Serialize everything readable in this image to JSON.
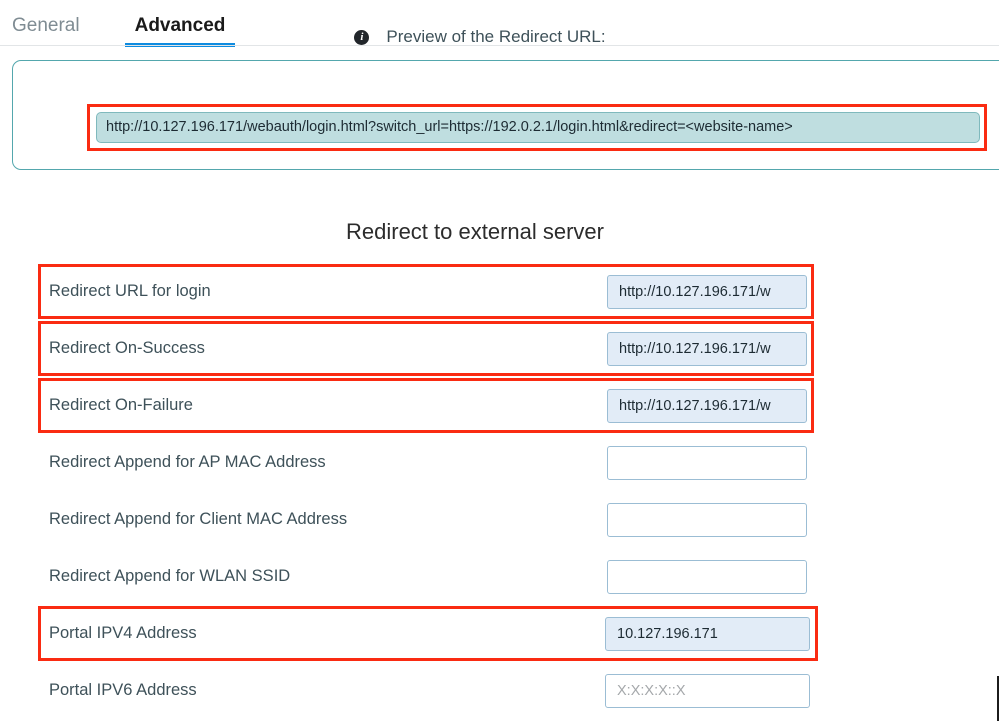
{
  "tabs": [
    {
      "label": "General",
      "active": false
    },
    {
      "label": "Advanced",
      "active": true
    }
  ],
  "preview": {
    "info_icon": "info-icon",
    "label": "Preview of the Redirect URL:",
    "url": "http://10.127.196.171/webauth/login.html?switch_url=https://192.0.2.1/login.html&redirect=<website-name>"
  },
  "section": {
    "title": "Redirect to external server"
  },
  "fields": [
    {
      "label": "Redirect URL for login",
      "value": "http://10.127.196.171/w",
      "placeholder": "",
      "highlighted": true,
      "filled": true
    },
    {
      "label": "Redirect On-Success",
      "value": "http://10.127.196.171/w",
      "placeholder": "",
      "highlighted": true,
      "filled": true
    },
    {
      "label": "Redirect On-Failure",
      "value": "http://10.127.196.171/w",
      "placeholder": "",
      "highlighted": true,
      "filled": true
    },
    {
      "label": "Redirect Append for AP MAC Address",
      "value": "",
      "placeholder": "",
      "highlighted": false,
      "filled": false
    },
    {
      "label": "Redirect Append for Client MAC Address",
      "value": "",
      "placeholder": "",
      "highlighted": false,
      "filled": false
    },
    {
      "label": "Redirect Append for WLAN SSID",
      "value": "",
      "placeholder": "",
      "highlighted": false,
      "filled": false
    },
    {
      "label": "Portal IPV4 Address",
      "value": "10.127.196.171",
      "placeholder": "",
      "highlighted": true,
      "filled": true
    },
    {
      "label": "Portal IPV6 Address",
      "value": "",
      "placeholder": "X:X:X:X::X",
      "highlighted": false,
      "filled": false
    }
  ],
  "colors": {
    "accent_tab": "#0f8ce0",
    "highlight_red": "#fa2b12",
    "panel_teal": "#53a7ad",
    "preview_field_bg": "#bfdee0",
    "field_filled_bg": "#e2ecf7",
    "field_border": "#9bbdd4",
    "label_text": "#3e5159"
  }
}
